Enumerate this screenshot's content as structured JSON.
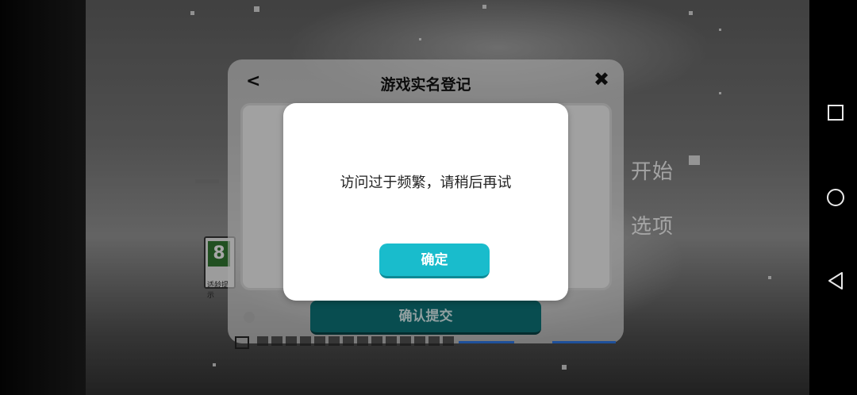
{
  "game": {
    "menu": [
      "开始",
      "选项"
    ],
    "age_rating": {
      "number": "8",
      "label": "适龄提示"
    }
  },
  "registration_dialog": {
    "title": "游戏实名登记",
    "back_glyph": "<",
    "close_glyph": "✖",
    "submit_label": "确认提交"
  },
  "alert": {
    "message": "访问过于频繁，请稍后再试",
    "confirm_label": "确定",
    "accent_color": "#19bccc"
  },
  "system_nav": {
    "icons": [
      "recent-apps-icon",
      "home-icon",
      "back-icon"
    ]
  }
}
